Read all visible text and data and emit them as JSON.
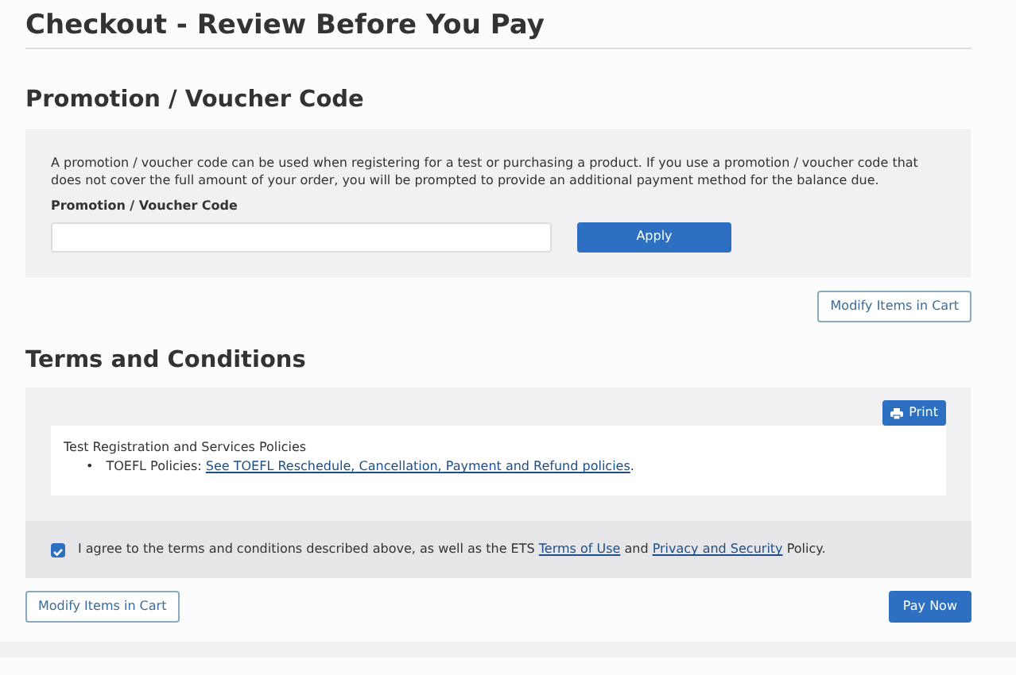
{
  "page_title": "Checkout - Review Before You Pay",
  "promotion": {
    "heading": "Promotion / Voucher Code",
    "description": "A promotion / voucher code can be used when registering for a test or purchasing a product. If you use a promotion / voucher code that does not cover the full amount of your order, you will be prompted to provide an additional payment method for the balance due.",
    "field_label": "Promotion / Voucher Code",
    "apply_button": "Apply",
    "modify_button": "Modify Items in Cart"
  },
  "terms": {
    "heading": "Terms and Conditions",
    "print_button": "Print",
    "policies_title": "Test Registration and Services Policies",
    "policies": [
      {
        "bullet": "•",
        "label": "TOEFL Policies: ",
        "link": "See TOEFL Reschedule, Cancellation, Payment and Refund policies",
        "after": "."
      }
    ],
    "agreement": {
      "checked": true,
      "text_before": "I agree to the terms and conditions described above, as well as the ETS ",
      "link_1": "Terms of Use",
      "text_middle": " and ",
      "link_2": "Privacy and Security",
      "text_after": " Policy."
    }
  },
  "footer": {
    "modify_button": "Modify Items in Cart",
    "pay_button": "Pay Now"
  }
}
